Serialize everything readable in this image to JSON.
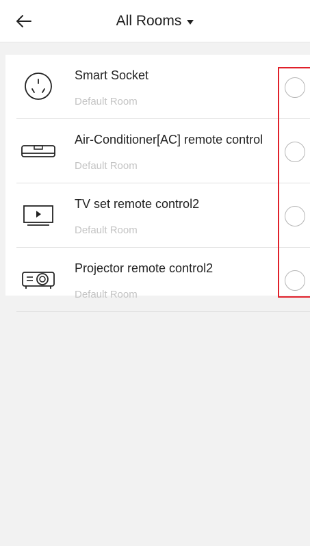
{
  "header": {
    "title": "All Rooms",
    "back_icon": "arrow-left-icon",
    "dropdown_icon": "caret-down-icon"
  },
  "devices": [
    {
      "name": "Smart Socket",
      "room": "Default Room",
      "icon": "socket-icon",
      "selected": false
    },
    {
      "name": "Air-Conditioner[AC] remote control",
      "room": "Default Room",
      "icon": "air-conditioner-icon",
      "selected": false
    },
    {
      "name": "TV set remote control2",
      "room": "Default Room",
      "icon": "tv-icon",
      "selected": false
    },
    {
      "name": "Projector remote control2",
      "room": "Default Room",
      "icon": "projector-icon",
      "selected": false
    }
  ],
  "colors": {
    "background": "#f2f2f2",
    "text_primary": "#222222",
    "text_secondary": "#c4c4c4",
    "radio_border": "#b5b5b5",
    "highlight": "#e0202a"
  }
}
